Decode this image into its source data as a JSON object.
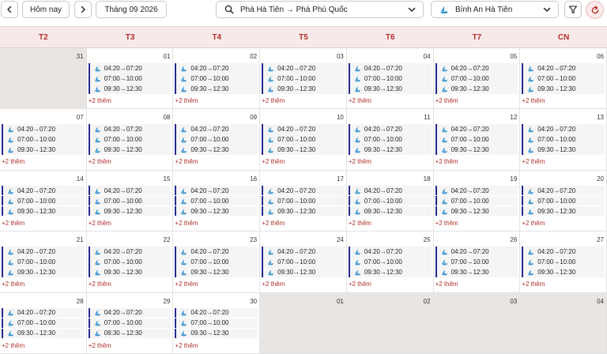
{
  "toolbar": {
    "today_label": "Hôm nay",
    "month_label": "Tháng 09 2026",
    "route": "Phà Hà Tiên → Phà Phú Quốc",
    "operator": "Bình An Hà Tiên"
  },
  "weekdays": [
    "T2",
    "T3",
    "T4",
    "T5",
    "T6",
    "T7",
    "CN"
  ],
  "trips": [
    "04:20→07:20",
    "07:00→10:00",
    "09:30→12:30"
  ],
  "more_label": "+2 thêm",
  "days": [
    {
      "num": "31",
      "in_month": false
    },
    {
      "num": "01",
      "in_month": true
    },
    {
      "num": "02",
      "in_month": true
    },
    {
      "num": "03",
      "in_month": true
    },
    {
      "num": "04",
      "in_month": true
    },
    {
      "num": "05",
      "in_month": true
    },
    {
      "num": "06",
      "in_month": true
    },
    {
      "num": "07",
      "in_month": true
    },
    {
      "num": "08",
      "in_month": true
    },
    {
      "num": "09",
      "in_month": true
    },
    {
      "num": "10",
      "in_month": true
    },
    {
      "num": "11",
      "in_month": true
    },
    {
      "num": "12",
      "in_month": true
    },
    {
      "num": "13",
      "in_month": true
    },
    {
      "num": "14",
      "in_month": true
    },
    {
      "num": "15",
      "in_month": true
    },
    {
      "num": "16",
      "in_month": true
    },
    {
      "num": "17",
      "in_month": true
    },
    {
      "num": "18",
      "in_month": true
    },
    {
      "num": "19",
      "in_month": true
    },
    {
      "num": "20",
      "in_month": true
    },
    {
      "num": "21",
      "in_month": true
    },
    {
      "num": "22",
      "in_month": true
    },
    {
      "num": "23",
      "in_month": true
    },
    {
      "num": "24",
      "in_month": true
    },
    {
      "num": "25",
      "in_month": true
    },
    {
      "num": "26",
      "in_month": true
    },
    {
      "num": "27",
      "in_month": true
    },
    {
      "num": "28",
      "in_month": true
    },
    {
      "num": "29",
      "in_month": true
    },
    {
      "num": "30",
      "in_month": true
    },
    {
      "num": "01",
      "in_month": false
    },
    {
      "num": "02",
      "in_month": false
    },
    {
      "num": "03",
      "in_month": false
    },
    {
      "num": "04",
      "in_month": false
    }
  ],
  "icons": {
    "prev": "chevron-left-icon",
    "next": "chevron-right-icon",
    "search": "search-icon",
    "dropdown": "chevron-down-icon",
    "ship": "ship-icon",
    "filter": "filter-icon",
    "refresh": "refresh-icon"
  },
  "colors": {
    "accent_red": "#b1302c",
    "header_bg": "#f8e9e9",
    "trip_bar": "#262a8c",
    "ship_blue": "#2f8fcf",
    "outside_month_bg": "#e9e5e3"
  }
}
